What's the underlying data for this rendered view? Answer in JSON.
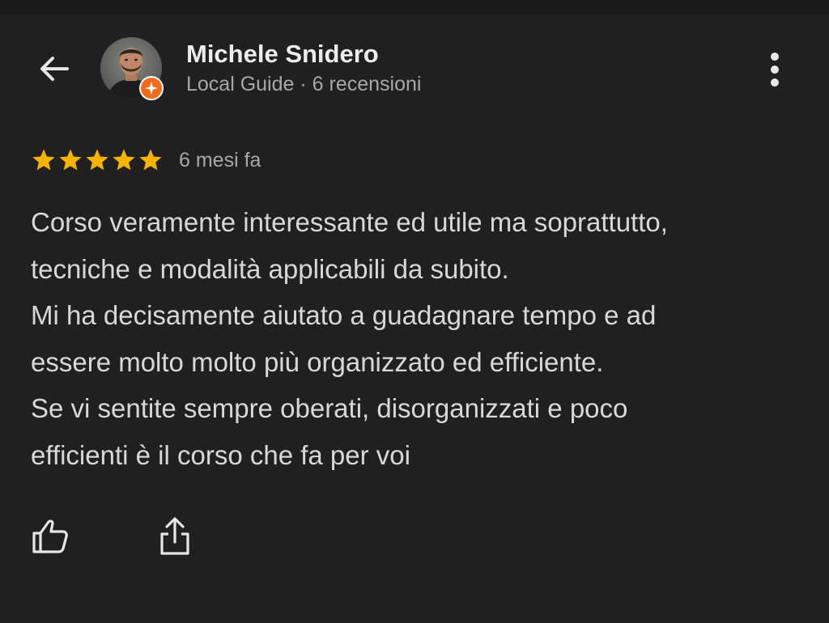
{
  "header": {
    "back_icon": "arrow-left-icon",
    "reviewer_name": "Michele Snidero",
    "reviewer_meta": "Local Guide · 6 recensioni",
    "avatar_badge_icon": "local-guide-star-badge-icon",
    "more_icon": "more-vertical-icon"
  },
  "review": {
    "rating": 5,
    "rating_max": 5,
    "time_ago": "6 mesi fa",
    "star_color": "#f6b400",
    "lines": [
      "Corso veramente interessante ed utile ma soprattutto,",
      "tecniche e modalità applicabili da subito.",
      "Mi ha decisamente aiutato a guadagnare tempo e ad",
      "essere molto molto più organizzato ed efficiente.",
      "Se vi sentite sempre oberati, disorganizzati e poco",
      "efficienti è il corso che fa per voi"
    ]
  },
  "actions": {
    "like_icon": "thumbs-up-icon",
    "share_icon": "share-icon"
  },
  "colors": {
    "background": "#202020",
    "badge": "#f26b1d"
  }
}
